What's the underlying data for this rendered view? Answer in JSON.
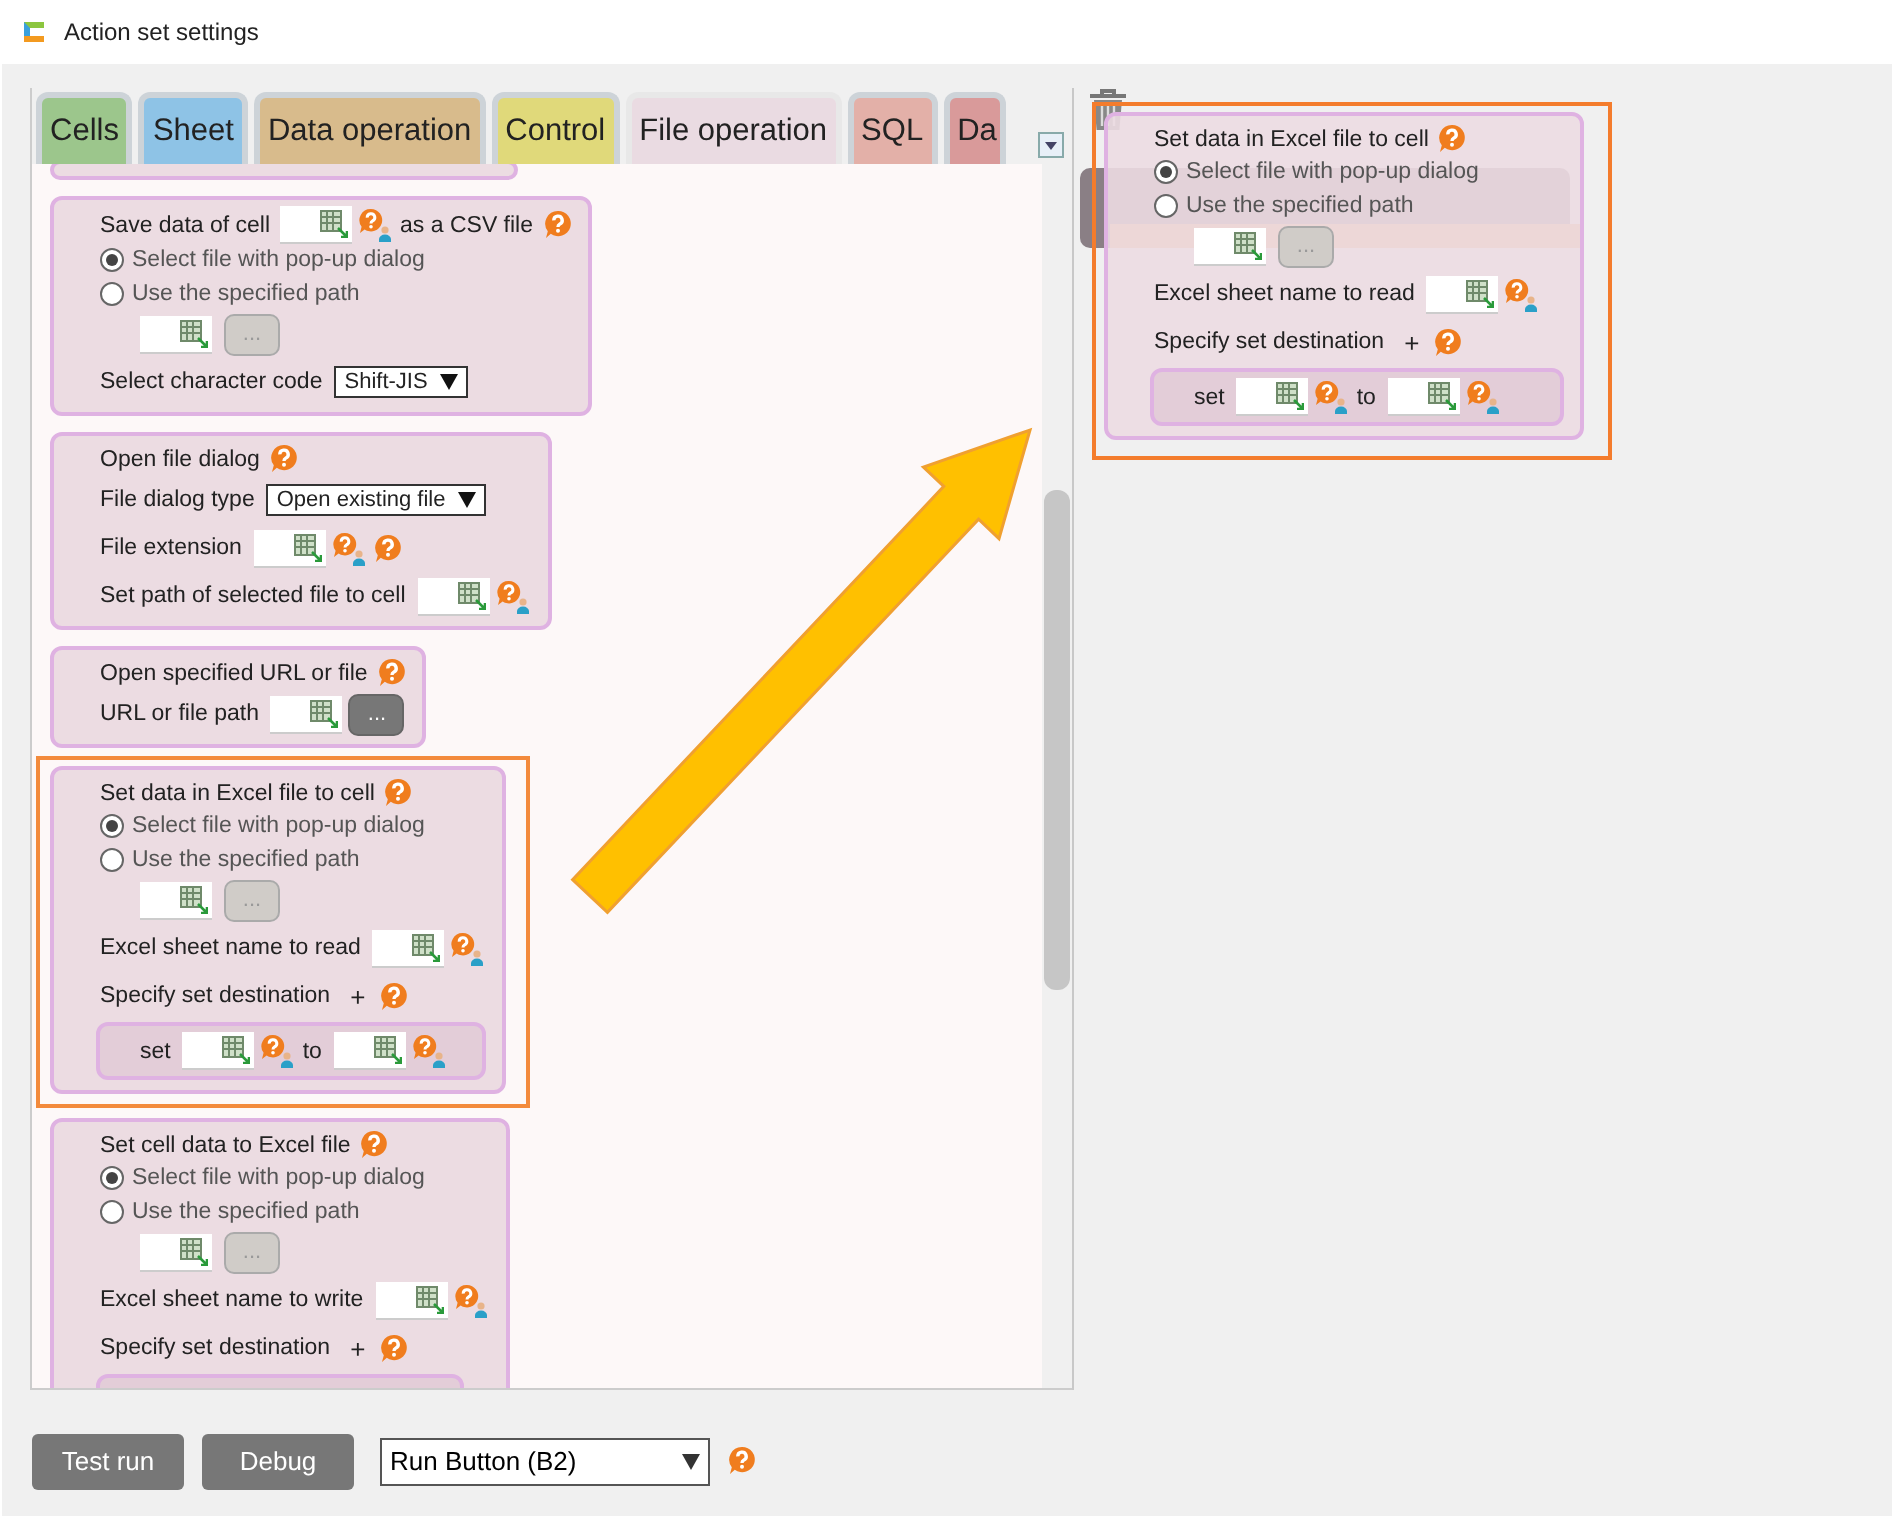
{
  "window": {
    "title": "Action set settings"
  },
  "tabs": [
    {
      "label": "Cells",
      "color": "#9cc68c",
      "selected": false
    },
    {
      "label": "Sheet",
      "color": "#8ec3e6",
      "selected": false
    },
    {
      "label": "Data operation",
      "color": "#d8bb8c",
      "selected": false
    },
    {
      "label": "Control",
      "color": "#e0d97a",
      "selected": false
    },
    {
      "label": "File operation",
      "color": "#eadbe2",
      "selected": true
    },
    {
      "label": "SQL",
      "color": "#e3b0a8",
      "selected": false
    },
    {
      "label": "Da",
      "color": "#d99a9a",
      "selected": false
    }
  ],
  "cards": [
    {
      "clipped": true,
      "highlighted": false
    },
    {
      "title": "Save data of cell",
      "title_cell": true,
      "title_after": "as a CSV file",
      "help": true,
      "highlighted": false,
      "rows": [
        {
          "kind": "radio",
          "label": "Select file with pop-up dialog",
          "selected": true
        },
        {
          "kind": "radio",
          "label": "Use the specified path",
          "selected": false
        },
        {
          "kind": "path",
          "button_label": "...",
          "button_enabled": false
        },
        {
          "kind": "select",
          "label": "Select character code",
          "value": "Shift-JIS"
        }
      ]
    },
    {
      "title": "Open file dialog",
      "help": true,
      "highlighted": false,
      "rows": [
        {
          "kind": "select",
          "label": "File dialog type",
          "value": "Open existing file"
        },
        {
          "kind": "cell",
          "label": "File extension",
          "cell_help": true,
          "help": true
        },
        {
          "kind": "cell",
          "label": "Set path of selected file to cell",
          "cell_help": true
        }
      ]
    },
    {
      "title": "Open specified URL or file",
      "help": true,
      "highlighted": false,
      "rows": [
        {
          "kind": "cell",
          "label": "URL or file path",
          "button_label": "...",
          "button_enabled": true
        }
      ]
    },
    {
      "title": "Set data in Excel file to cell",
      "help": true,
      "highlighted": true,
      "rows": [
        {
          "kind": "radio",
          "label": "Select file with pop-up dialog",
          "selected": true
        },
        {
          "kind": "radio",
          "label": "Use the specified path",
          "selected": false
        },
        {
          "kind": "path",
          "button_label": "...",
          "button_enabled": false
        },
        {
          "kind": "cell",
          "label": "Excel sheet name to read",
          "cell_help": true
        },
        {
          "kind": "destination",
          "label": "Specify set destination",
          "add": "+",
          "help": true,
          "set_label": "set",
          "to_label": "to"
        }
      ]
    },
    {
      "title": "Set cell data to Excel file",
      "help": true,
      "highlighted": false,
      "rows": [
        {
          "kind": "radio",
          "label": "Select file with pop-up dialog",
          "selected": true
        },
        {
          "kind": "radio",
          "label": "Use the specified path",
          "selected": false
        },
        {
          "kind": "path",
          "button_label": "...",
          "button_enabled": false
        },
        {
          "kind": "cell",
          "label": "Excel sheet name to write",
          "cell_help": true
        },
        {
          "kind": "destination",
          "label": "Specify set destination",
          "add": "+",
          "help": true
        }
      ]
    }
  ],
  "drag_preview": {
    "title": "Set data in Excel file to cell",
    "help": true,
    "highlighted": true,
    "rows": [
      {
        "kind": "radio",
        "label": "Select file with pop-up dialog",
        "selected": true
      },
      {
        "kind": "radio",
        "label": "Use the specified path",
        "selected": false
      },
      {
        "kind": "path",
        "button_label": "...",
        "button_enabled": false
      },
      {
        "kind": "cell",
        "label": "Excel sheet name to read",
        "cell_help": true
      },
      {
        "kind": "destination",
        "label": "Specify set destination",
        "add": "+",
        "help": true,
        "set_label": "set",
        "to_label": "to"
      }
    ]
  },
  "footer": {
    "buttons": [
      "Test run",
      "Debug"
    ],
    "target": {
      "value": "Run Button (B2)"
    }
  }
}
